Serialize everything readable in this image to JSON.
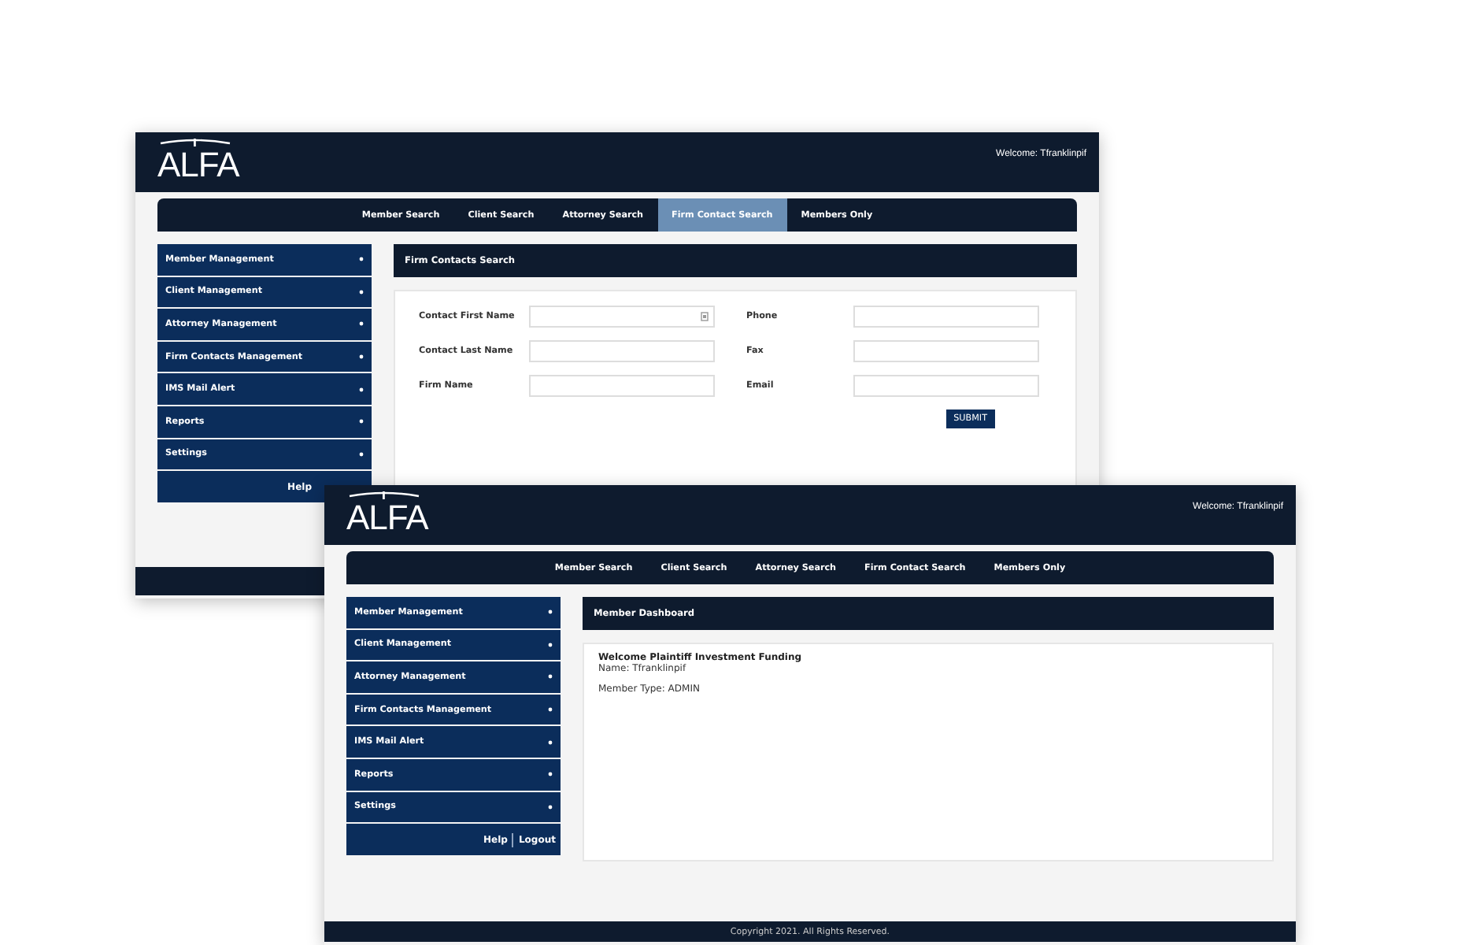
{
  "screens": [
    {
      "kind": "search_form",
      "logo": "ALFA",
      "welcome": "Welcome: Tfranklinpif",
      "nav": [
        {
          "label": "Member Search",
          "selected": false
        },
        {
          "label": "Client Search",
          "selected": false
        },
        {
          "label": "Attorney Search",
          "selected": false
        },
        {
          "label": "Firm Contact Search",
          "selected": true
        },
        {
          "label": "Members Only",
          "selected": false
        }
      ],
      "sidebar": [
        "Member Management",
        "Client Management",
        "Attorney Management",
        "Firm Contacts Management",
        "IMS Mail Alert",
        "Reports",
        "Settings"
      ],
      "sidebar_links": [
        "Help"
      ],
      "panel_title": "Firm Contacts Search",
      "fields": [
        {
          "label": "Contact First Name"
        },
        {
          "label": "Phone"
        },
        {
          "label": "Contact Last Name"
        },
        {
          "label": "Fax"
        },
        {
          "label": "Firm Name"
        },
        {
          "label": "Email"
        }
      ],
      "submit": "SUBMIT"
    },
    {
      "kind": "dashboard",
      "logo": "ALFA",
      "welcome": "Welcome: Tfranklinpif",
      "nav": [
        {
          "label": "Member Search",
          "selected": false
        },
        {
          "label": "Client Search",
          "selected": false
        },
        {
          "label": "Attorney Search",
          "selected": false
        },
        {
          "label": "Firm Contact Search",
          "selected": false
        },
        {
          "label": "Members Only",
          "selected": false
        }
      ],
      "sidebar": [
        "Member Management",
        "Client Management",
        "Attorney Management",
        "Firm Contacts Management",
        "IMS Mail Alert",
        "Reports",
        "Settings"
      ],
      "sidebar_links": [
        "Help",
        "Logout"
      ],
      "panel_title": "Member Dashboard",
      "greeting": "Welcome Plaintiff Investment Funding",
      "lines": [
        "Name: Tfranklinpif",
        "Member Type: ADMIN"
      ],
      "footer": "Copyright 2021. All Rights Reserved."
    }
  ]
}
